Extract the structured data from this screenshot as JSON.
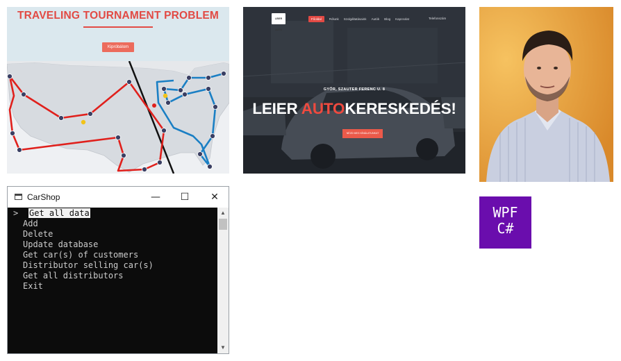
{
  "ttp": {
    "title": "TRAVELING TOURNAMENT PROBLEM",
    "button_label": "Kipróbálom",
    "colors": {
      "title": "#e24a44",
      "route_west": "#e0201c",
      "route_east": "#1a7fc4",
      "divider": "#111111"
    }
  },
  "dealer": {
    "logo_text": "LEIER AUTO",
    "nav": [
      "Főoldal",
      "Rólunk",
      "Szolgáltatásaink",
      "Autók",
      "Blog",
      "Kapcsolat"
    ],
    "phone": "Telefonszám",
    "address": "GYŐR, SZAUTER FERENC U. 8",
    "headline_pre": "LEIER ",
    "headline_accent": "AUTO",
    "headline_post": "KERESKEDÉS!",
    "cta_label": "NÉZD MEG KÍNÁLATUNKAT",
    "colors": {
      "accent": "#ef4a3f"
    }
  },
  "portrait": {
    "icon": "portrait-photo",
    "colors": {
      "background": "#e9a13b",
      "shirt": "#c9cfe0"
    }
  },
  "console": {
    "title": "CarShop",
    "controls": {
      "minimize": "—",
      "maximize": "☐",
      "close": "✕"
    },
    "cursor": ">",
    "selected_item": "Get all data",
    "menu_items": [
      "Add",
      "Delete",
      "Update database",
      "Get car(s) of customers",
      "Distributor selling car(s)",
      "Get all distributors",
      "Exit"
    ],
    "colors": {
      "background": "#0c0c0c",
      "text": "#cccccc"
    }
  },
  "wpf": {
    "line1": "WPF",
    "line2": "C#",
    "colors": {
      "background": "#6a0dad"
    }
  }
}
